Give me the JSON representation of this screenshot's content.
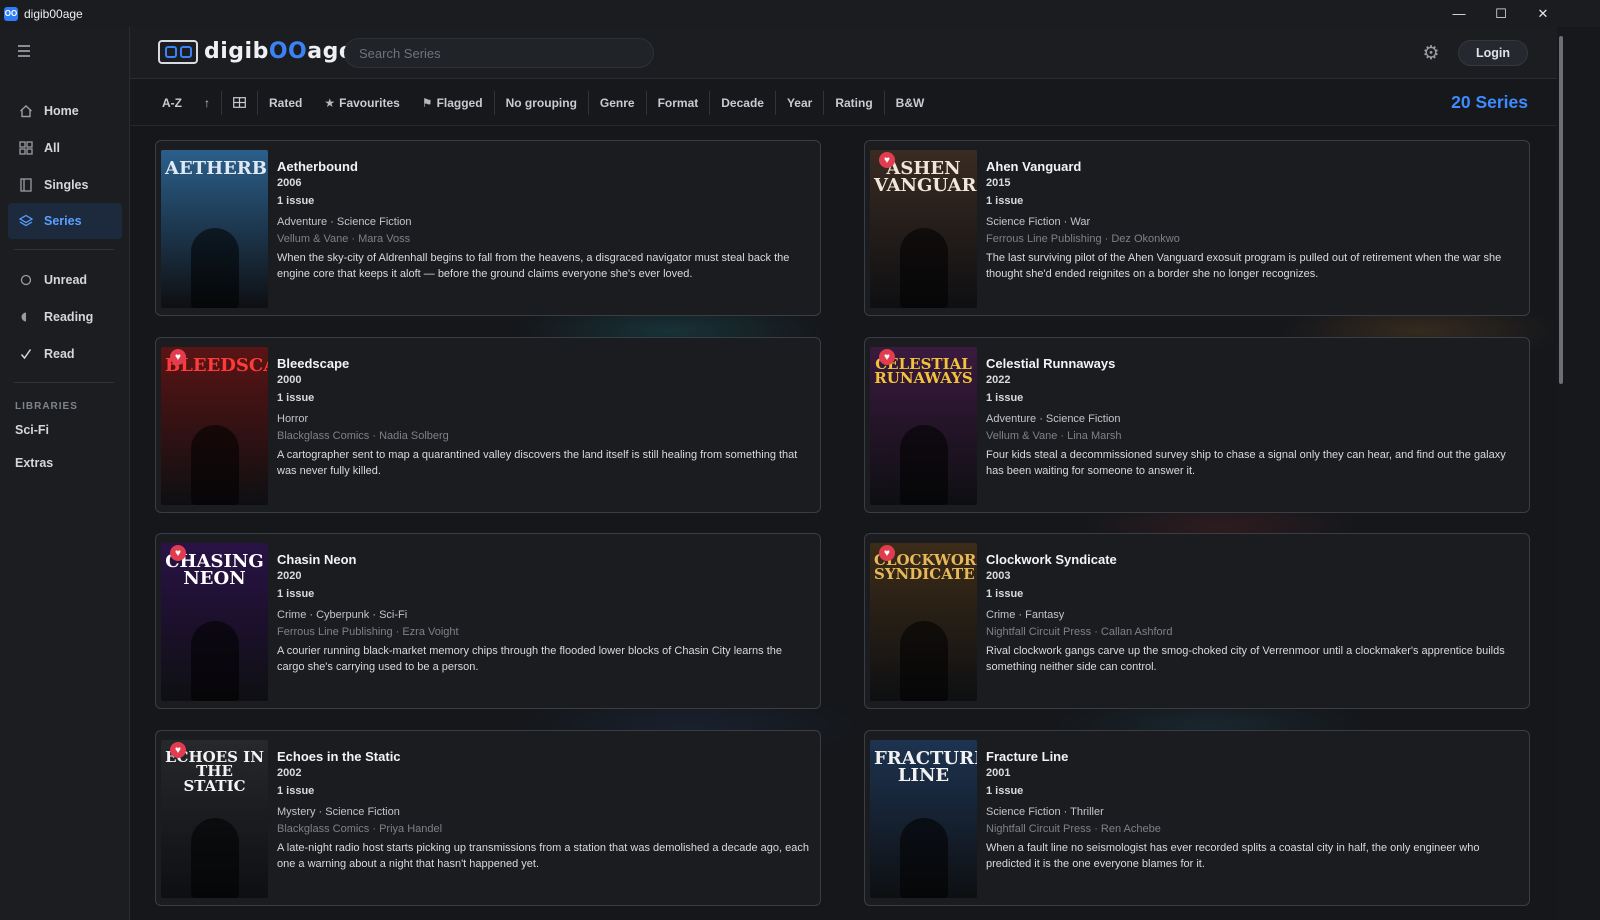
{
  "window": {
    "title": "digib00age",
    "app_icon": "OO",
    "minimize": "—",
    "maximize": "☐",
    "close": "✕"
  },
  "header": {
    "logo_prefix": "digib",
    "logo_accent": "OO",
    "logo_suffix": "age",
    "search_placeholder": "Search Series",
    "login_label": "Login",
    "settings_icon": "gear-icon"
  },
  "sidebar": {
    "nav": [
      {
        "label": "Home",
        "icon": "home-icon"
      },
      {
        "label": "All",
        "icon": "grid-icon"
      },
      {
        "label": "Singles",
        "icon": "book-icon"
      },
      {
        "label": "Series",
        "icon": "layers-icon"
      }
    ],
    "status": [
      {
        "label": "Unread",
        "icon": "circle-icon"
      },
      {
        "label": "Reading",
        "icon": "half-circle-icon"
      },
      {
        "label": "Read",
        "icon": "check-icon"
      }
    ],
    "libraries_heading": "LIBRARIES",
    "libraries": [
      {
        "label": "Sci-Fi"
      },
      {
        "label": "Extras"
      }
    ]
  },
  "toolbar": {
    "sort": "A-Z",
    "sort_dir": "↑",
    "view_icon": "grid-view-icon",
    "rated": "Rated",
    "favourites": "Favourites",
    "flagged": "Flagged",
    "grouping": "No grouping",
    "genre": "Genre",
    "format": "Format",
    "decade": "Decade",
    "year": "Year",
    "rating": "Rating",
    "bw": "B&W",
    "count": "20 Series"
  },
  "series": [
    {
      "title": "Aetherbound",
      "year": "2006",
      "issues": "1 issue",
      "genres": "Adventure · Science Fiction",
      "publisher": "Vellum & Vane · Mara Voss",
      "description": "When the sky-city of Aldrenhall begins to fall from the heavens, a disgraced navigator must steal back the engine core that keeps it aloft — before the ground claims everyone she's ever loved.",
      "cover_text": "AETHERBOUND",
      "cover_bg": "#2b5f8a",
      "cover_fg": "#dfe9f5",
      "flagged": false
    },
    {
      "title": "Ahen Vanguard",
      "year": "2015",
      "issues": "1 issue",
      "genres": "Science Fiction · War",
      "publisher": "Ferrous Line Publishing · Dez Okonkwo",
      "description": "The last surviving pilot of the Ahen Vanguard exosuit program is pulled out of retirement when the war she thought she'd ended reignites on a border she no longer recognizes.",
      "cover_text": "ASHEN VANGUARD",
      "cover_bg": "#3a2b22",
      "cover_fg": "#f1e6da",
      "flagged": true
    },
    {
      "title": "Bleedscape",
      "year": "2000",
      "issues": "1 issue",
      "genres": "Horror",
      "publisher": "Blackglass Comics · Nadia Solberg",
      "description": "A cartographer sent to map a quarantined valley discovers the land itself is still healing from something that was never fully killed.",
      "cover_text": "BLEEDSCAPE",
      "cover_bg": "#5a1414",
      "cover_fg": "#ff3a3a",
      "flagged": true
    },
    {
      "title": "Celestial Runnaways",
      "year": "2022",
      "issues": "1 issue",
      "genres": "Adventure · Science Fiction",
      "publisher": "Vellum & Vane · Lina Marsh",
      "description": "Four kids steal a decommissioned survey ship to chase a signal only they can hear, and find out the galaxy has been waiting for someone to answer it.",
      "cover_text": "CELESTIAL RUNAWAYS",
      "cover_bg": "#3a1a3e",
      "cover_fg": "#f2c23a",
      "flagged": true
    },
    {
      "title": "Chasin Neon",
      "year": "2020",
      "issues": "1 issue",
      "genres": "Crime · Cyberpunk · Sci-Fi",
      "publisher": "Ferrous Line Publishing · Ezra Voight",
      "description": "A courier running black-market memory chips through the flooded lower blocks of Chasin City learns the cargo she's carrying used to be a person.",
      "cover_text": "CHASING NEON",
      "cover_bg": "#2a1246",
      "cover_fg": "#ffffff",
      "flagged": true
    },
    {
      "title": "Clockwork Syndicate",
      "year": "2003",
      "issues": "1 issue",
      "genres": "Crime · Fantasy",
      "publisher": "Nightfall Circuit Press · Callan Ashford",
      "description": "Rival clockwork gangs carve up the smog-choked city of Verrenmoor until a clockmaker's apprentice builds something neither side can control.",
      "cover_text": "CLOCKWORK SYNDICATE",
      "cover_bg": "#3c2c18",
      "cover_fg": "#e8b85a",
      "flagged": true
    },
    {
      "title": "Echoes in the Static",
      "year": "2002",
      "issues": "1 issue",
      "genres": "Mystery · Science Fiction",
      "publisher": "Blackglass Comics · Priya Handel",
      "description": "A late-night radio host starts picking up transmissions from a station that was demolished a decade ago, each one a warning about a night that hasn't happened yet.",
      "cover_text": "ECHOES IN THE STATIC",
      "cover_bg": "#26282c",
      "cover_fg": "#f4f4f4",
      "flagged": true
    },
    {
      "title": "Fracture Line",
      "year": "2001",
      "issues": "1 issue",
      "genres": "Science Fiction · Thriller",
      "publisher": "Nightfall Circuit Press · Ren Achebe",
      "description": "When a fault line no seismologist has ever recorded splits a coastal city in half, the only engineer who predicted it is the one everyone blames for it.",
      "cover_text": "FRACTURE LINE",
      "cover_bg": "#1d3350",
      "cover_fg": "#f2f2f2",
      "flagged": false
    }
  ]
}
